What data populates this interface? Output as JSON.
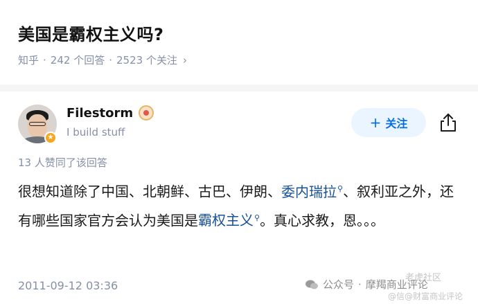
{
  "question": {
    "title": "美国是霸权主义吗?",
    "source": "知乎",
    "answers_count": "242 个回答",
    "followers_count": "2523 个关注",
    "chevron": "›"
  },
  "author": {
    "name": "Filestorm",
    "bio": "I build stuff",
    "follow_label": "关注",
    "follow_icon": "plus-icon",
    "share_icon": "share-icon"
  },
  "answer": {
    "likes": "13 人赞同了该回答",
    "text_part1": "很想知道除了中国、北朝鲜、古巴、伊朗、",
    "link1": "委内瑞拉",
    "text_part2": "、叙利亚之外，还有哪些国家官方会认为美国是",
    "link2": "霸权主义",
    "text_part3": "。真心求教，恩。。。",
    "date": "2011-09-12 03:36"
  },
  "watermark": {
    "label": "公众号",
    "name": "摩羯商业评论",
    "overlay_top": "老虎社区",
    "overlay_bottom": "@信@财富商业评论"
  },
  "colors": {
    "link": "#175199",
    "follow_bg": "#ebf5ff",
    "follow_text": "#056de8",
    "meta_gray": "#8590a6"
  }
}
